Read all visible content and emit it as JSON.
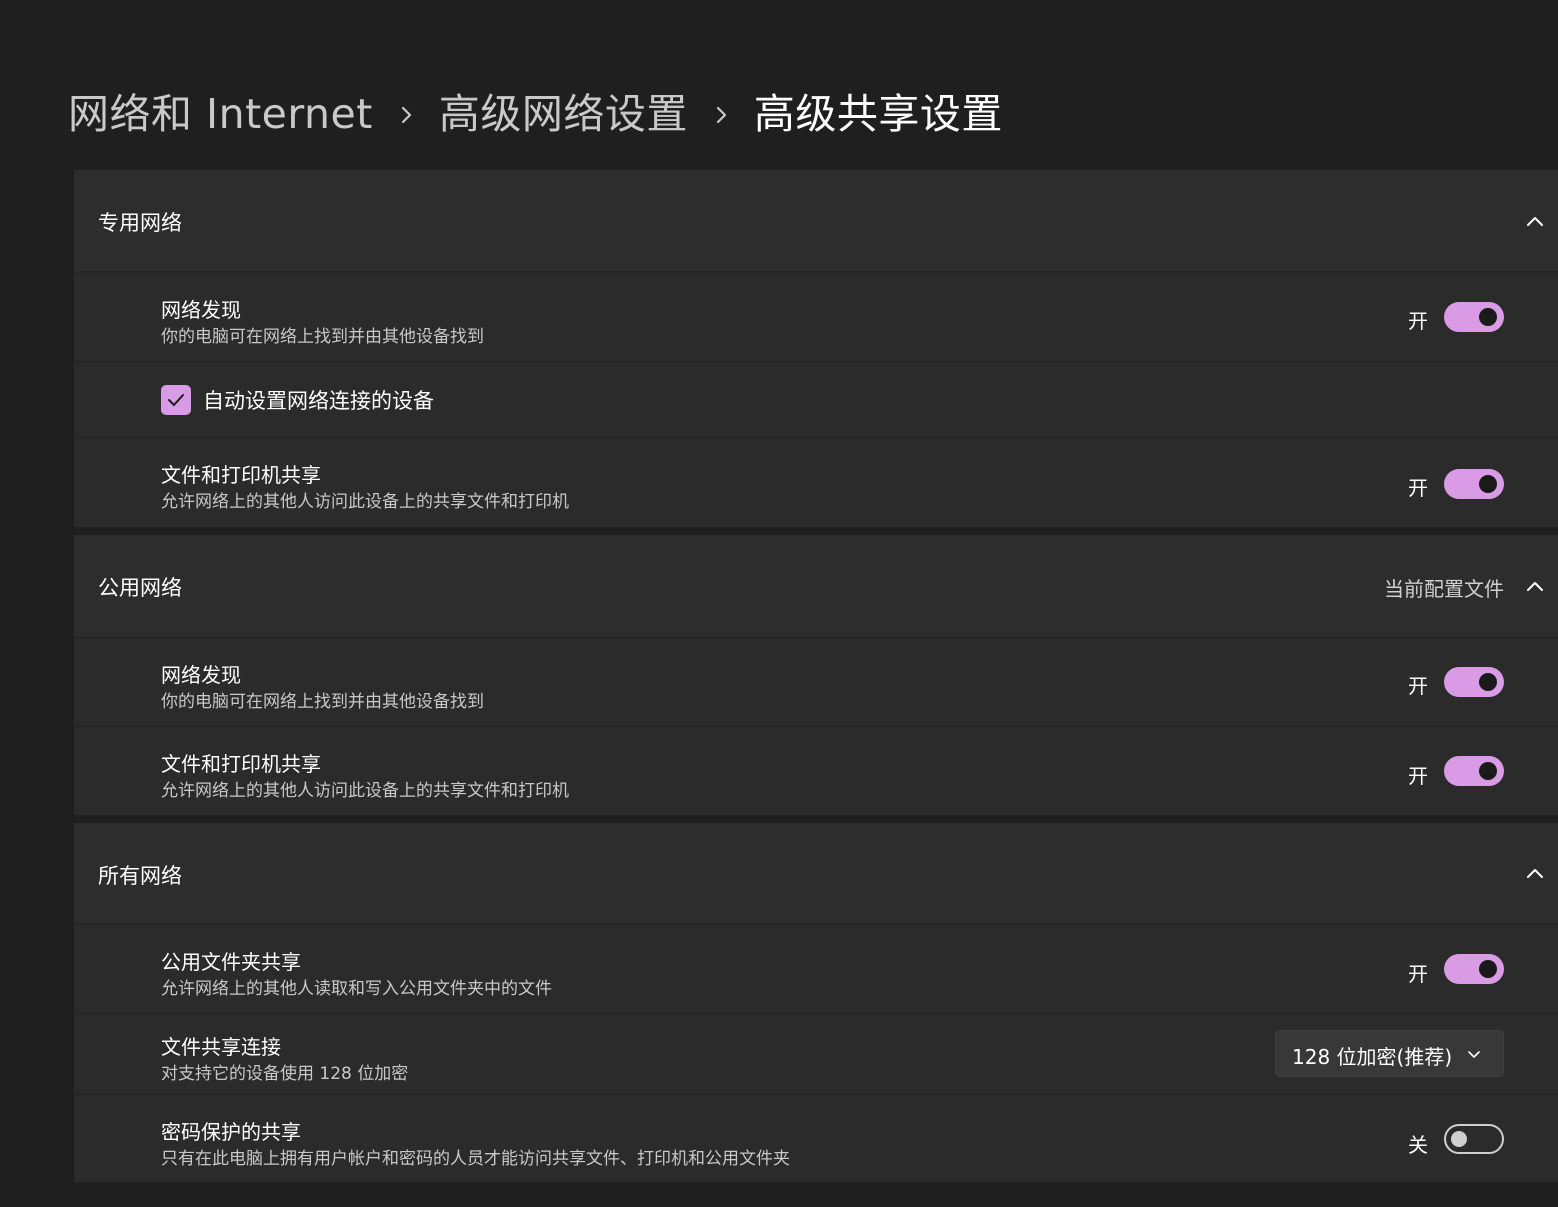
{
  "breadcrumb": {
    "items": [
      {
        "label": "网络和 Internet"
      },
      {
        "label": "高级网络设置"
      },
      {
        "label": "高级共享设置"
      }
    ]
  },
  "sections": {
    "private": {
      "title": "专用网络",
      "network_discovery": {
        "title": "网络发现",
        "description": "你的电脑可在网络上找到并由其他设备找到",
        "state_label": "开",
        "on": true
      },
      "auto_setup": {
        "label": "自动设置网络连接的设备",
        "checked": true
      },
      "file_printer_sharing": {
        "title": "文件和打印机共享",
        "description": "允许网络上的其他人访问此设备上的共享文件和打印机",
        "state_label": "开",
        "on": true
      }
    },
    "public": {
      "title": "公用网络",
      "badge": "当前配置文件",
      "network_discovery": {
        "title": "网络发现",
        "description": "你的电脑可在网络上找到并由其他设备找到",
        "state_label": "开",
        "on": true
      },
      "file_printer_sharing": {
        "title": "文件和打印机共享",
        "description": "允许网络上的其他人访问此设备上的共享文件和打印机",
        "state_label": "开",
        "on": true
      }
    },
    "all": {
      "title": "所有网络",
      "public_folder_sharing": {
        "title": "公用文件夹共享",
        "description": "允许网络上的其他人读取和写入公用文件夹中的文件",
        "state_label": "开",
        "on": true
      },
      "file_sharing_connections": {
        "title": "文件共享连接",
        "description": "对支持它的设备使用 128 位加密",
        "selected": "128 位加密(推荐)"
      },
      "password_protected_sharing": {
        "title": "密码保护的共享",
        "description": "只有在此电脑上拥有用户帐户和密码的人员才能访问共享文件、打印机和公用文件夹",
        "state_label": "关",
        "on": false
      }
    }
  },
  "colors": {
    "accent": "#d99be6",
    "background": "#1f1f1f",
    "card": "#2b2b2b"
  }
}
